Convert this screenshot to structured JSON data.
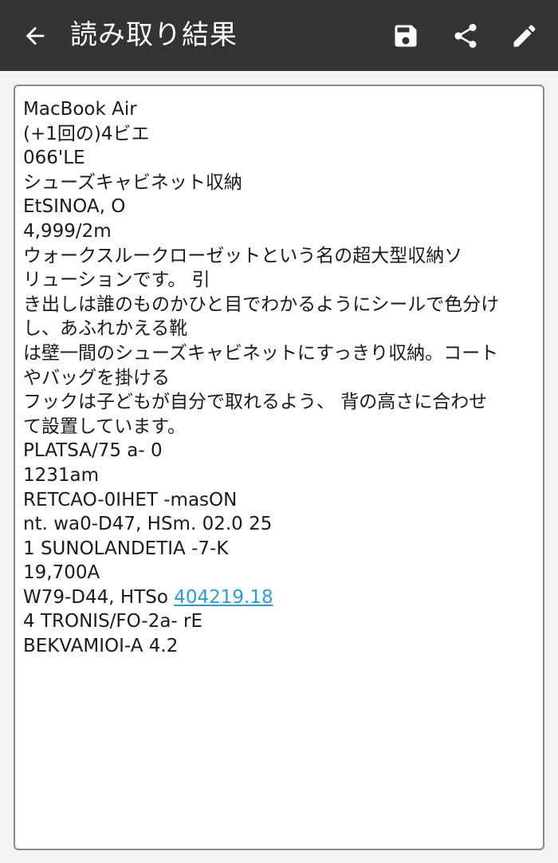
{
  "app_bar": {
    "title": "読み取り結果",
    "background": "#333333",
    "icons": {
      "back": "arrow-back-icon",
      "save": "save-floppy-icon",
      "share": "share-icon",
      "edit": "pencil-edit-icon"
    }
  },
  "result": {
    "link_color": "#2f9bd6",
    "lines": [
      "MacBook Air",
      "(+1回の)4ビエ",
      "066'LE",
      "シューズキャビネット収納",
      "EtSINOA, O",
      "4,999/2m",
      "ウォークスルークローゼットという名の超大型収納ソ",
      "リューションです。 引",
      "き出しは誰のものかひと目でわかるようにシールで色分け",
      "し、あふれかえる靴",
      "は壁一間のシューズキャビネットにすっきり収納。コート",
      "やバッグを掛ける",
      "フックは子どもが自分で取れるよう、 背の高さに合わせ",
      "て設置しています。",
      "PLATSA/75 a- 0",
      "1231am",
      "RETCAO-0IHET -masON",
      "nt. wa0-D47, HSm. 02.0 25",
      "1 SUNOLANDETIA -7-K",
      "19,700A",
      "W79-D44, HTSo ",
      "4 TRONIS/FO-2a- rE",
      "BEKVAMIOI-A 4.2"
    ],
    "link_text": "404219.18"
  }
}
